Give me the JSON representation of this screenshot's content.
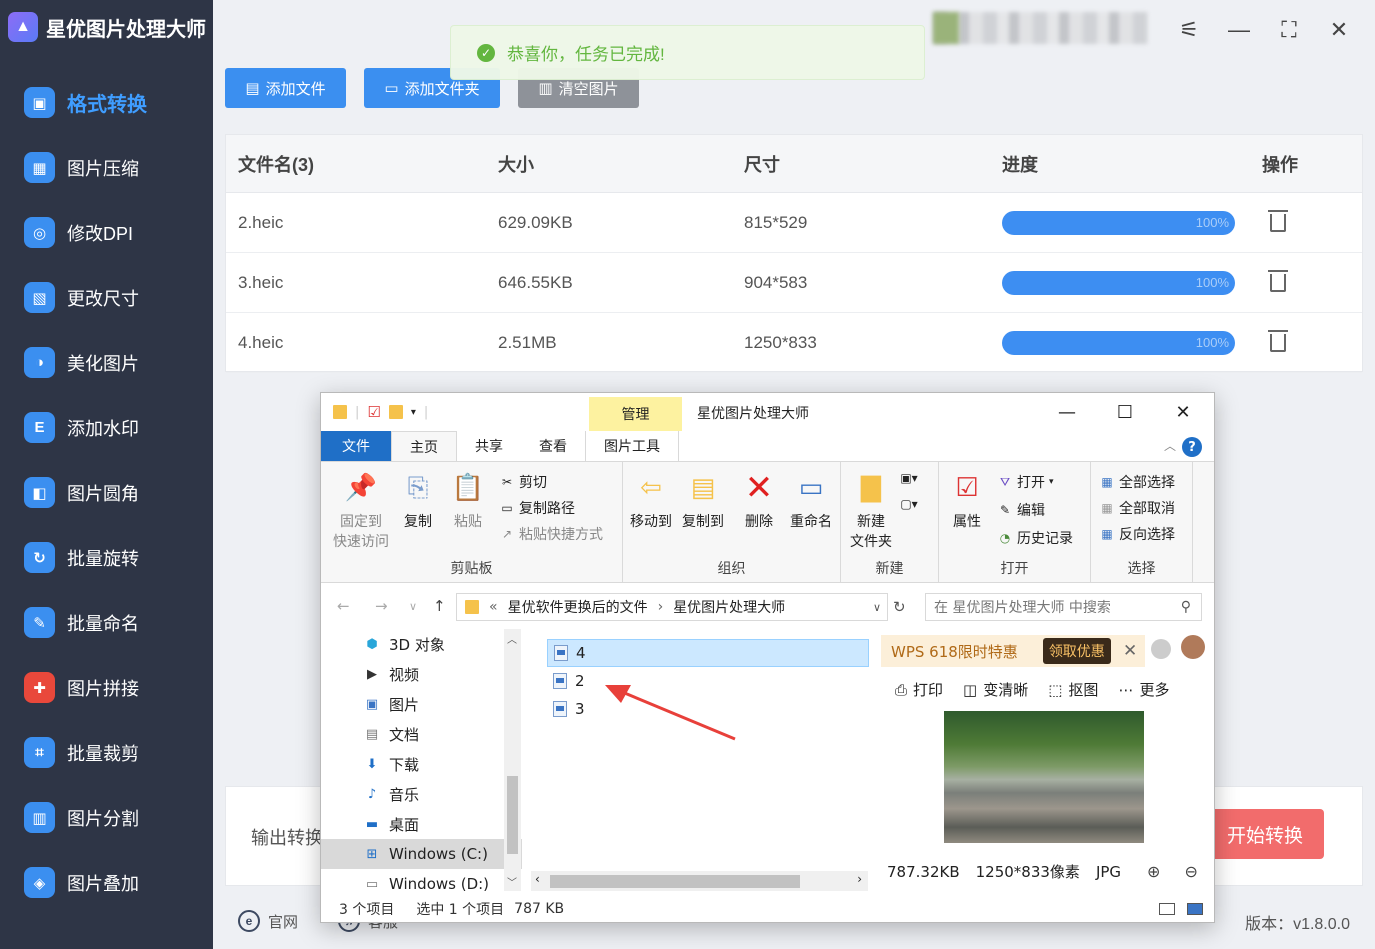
{
  "app": {
    "title": "星优图片处理大师",
    "version": "版本：v1.8.0.0"
  },
  "sidebar": {
    "items": [
      {
        "label": "格式转换",
        "color": "#3b8ff0",
        "active": true
      },
      {
        "label": "图片压缩",
        "color": "#3b8ff0"
      },
      {
        "label": "修改DPI",
        "color": "#3b8ff0"
      },
      {
        "label": "更改尺寸",
        "color": "#3b8ff0"
      },
      {
        "label": "美化图片",
        "color": "#3b8ff0"
      },
      {
        "label": "添加水印",
        "color": "#3b8ff0"
      },
      {
        "label": "图片圆角",
        "color": "#3b8ff0"
      },
      {
        "label": "批量旋转",
        "color": "#3b8ff0"
      },
      {
        "label": "批量命名",
        "color": "#3b8ff0"
      },
      {
        "label": "图片拼接",
        "color": "#e9483b"
      },
      {
        "label": "批量裁剪",
        "color": "#3b8ff0"
      },
      {
        "label": "图片分割",
        "color": "#3b8ff0"
      },
      {
        "label": "图片叠加",
        "color": "#3b8ff0"
      }
    ]
  },
  "toolbar": {
    "add_file": "添加文件",
    "add_folder": "添加文件夹",
    "clear": "清空图片"
  },
  "toast": {
    "message": "恭喜你，任务已完成!"
  },
  "table": {
    "headers": [
      "文件名(3)",
      "大小",
      "尺寸",
      "进度",
      "操作"
    ],
    "rows": [
      {
        "name": "2.heic",
        "size": "629.09KB",
        "dims": "815*529",
        "progress": "100%"
      },
      {
        "name": "3.heic",
        "size": "646.55KB",
        "dims": "904*583",
        "progress": "100%"
      },
      {
        "name": "4.heic",
        "size": "2.51MB",
        "dims": "1250*833",
        "progress": "100%"
      }
    ]
  },
  "bottom": {
    "output_label": "输出转换",
    "start_button": "开始转换"
  },
  "footer": {
    "website": "官网",
    "service": "客服"
  },
  "explorer": {
    "title": "星优图片处理大师",
    "manage_tab": "管理",
    "tabs": [
      "文件",
      "主页",
      "共享",
      "查看",
      "图片工具"
    ],
    "ribbon": {
      "pin": "固定到\n快速访问",
      "copy": "复制",
      "paste": "粘贴",
      "cut": "剪切",
      "copy_path": "复制路径",
      "paste_shortcut": "粘贴快捷方式",
      "clipboard": "剪贴板",
      "move_to": "移动到",
      "copy_to": "复制到",
      "delete": "删除",
      "rename": "重命名",
      "organize": "组织",
      "new_folder": "新建\n文件夹",
      "new": "新建",
      "properties": "属性",
      "open": "打开",
      "edit": "编辑",
      "history": "历史记录",
      "open_group": "打开",
      "select_all": "全部选择",
      "select_none": "全部取消",
      "invert": "反向选择",
      "select_group": "选择"
    },
    "address": {
      "part1": "星优软件更换后的文件",
      "part2": "星优图片处理大师"
    },
    "search_placeholder": "在 星优图片处理大师 中搜索",
    "tree": [
      "3D 对象",
      "视频",
      "图片",
      "文档",
      "下载",
      "音乐",
      "桌面",
      "Windows (C:)",
      "Windows (D:)"
    ],
    "files": [
      "4",
      "2",
      "3"
    ],
    "preview": {
      "ad_text": "WPS 618限时特惠",
      "ad_button": "领取优惠",
      "tools": [
        "打印",
        "变清晰",
        "抠图",
        "更多"
      ],
      "size": "787.32KB",
      "dims": "1250*833像素",
      "format": "JPG"
    },
    "status": {
      "count": "3 个项目",
      "selected": "选中 1 个项目",
      "size": "787 KB"
    }
  }
}
